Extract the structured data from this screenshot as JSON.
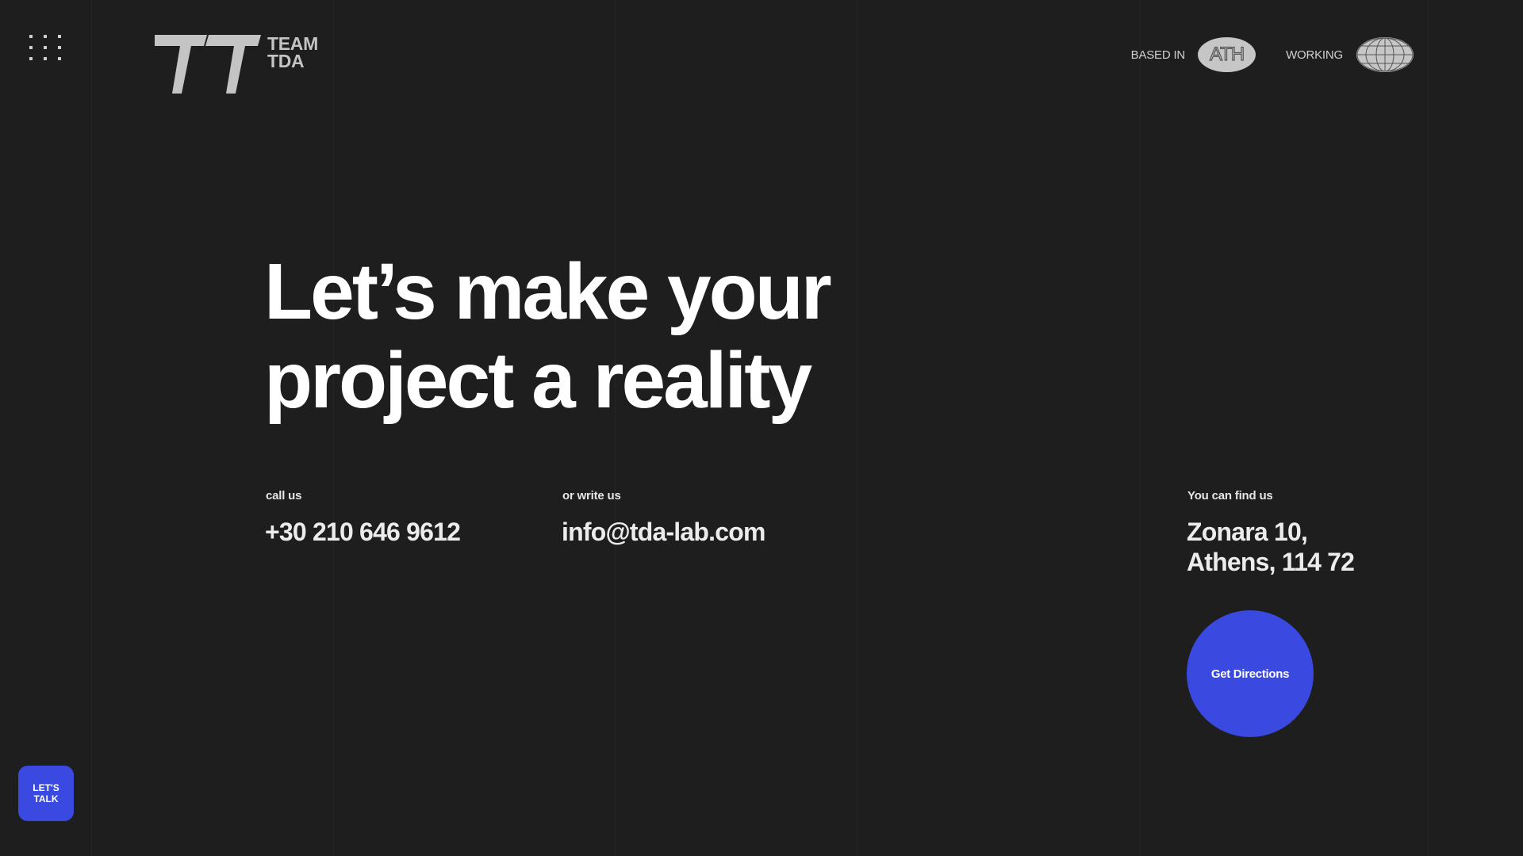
{
  "header": {
    "menu_icon": "grid-dots-icon",
    "logo": {
      "line1": "TEAM",
      "line2": "TDA"
    },
    "based_in_label": "BASED IN",
    "city_badge": "ATH",
    "working_label": "WORKING",
    "globe_icon": "globe-icon"
  },
  "hero": {
    "line1": "Let’s make your",
    "line2": "project a reality"
  },
  "contact": {
    "call_label": "call us",
    "phone": "+30 210 646 9612",
    "write_label": "or write us",
    "email": "info@tda-lab.com",
    "find_label": "You can find us",
    "address_line1": "Zonara 10,",
    "address_line2": "Athens, 114 72",
    "directions_label": "Get Directions"
  },
  "cta": {
    "line1": "LET'S",
    "line2": "TALK"
  },
  "colors": {
    "background": "#1e1e1f",
    "accent": "#3a4ae0",
    "logo_gray": "#c4c4c4"
  }
}
